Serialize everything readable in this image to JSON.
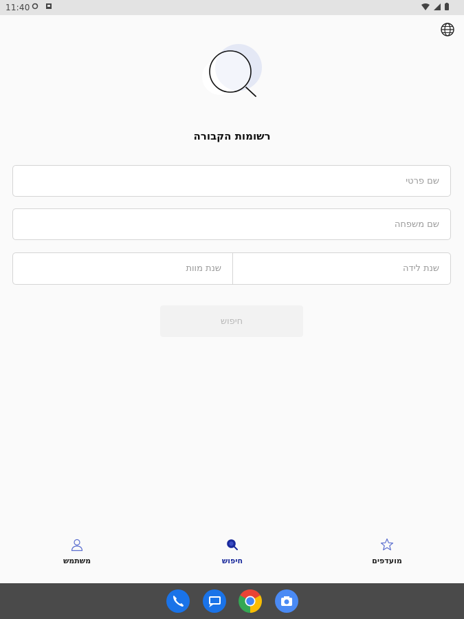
{
  "status_bar": {
    "time": "11:40"
  },
  "header": {
    "globe_icon": "globe-icon"
  },
  "main": {
    "title": "רשומות הקבורה",
    "first_name_placeholder": "שם פרטי",
    "first_name_value": "",
    "last_name_placeholder": "שם משפחה",
    "last_name_value": "",
    "birth_year_placeholder": "שנת לידה",
    "birth_year_value": "",
    "death_year_placeholder": "שנת מוות",
    "death_year_value": "",
    "search_button_label": "חיפוש"
  },
  "bottom_nav": {
    "items": [
      {
        "label": "מועדפים",
        "icon": "star-icon"
      },
      {
        "label": "חיפוש",
        "icon": "search-icon"
      },
      {
        "label": "משתמש",
        "icon": "user-icon"
      }
    ]
  },
  "dock": {
    "apps": [
      "phone",
      "messages",
      "chrome",
      "camera"
    ]
  },
  "colors": {
    "accent": "#1a2a9c",
    "hero_circle": "#e4e8f5",
    "nav_icon_inactive": "#5c6fcf"
  }
}
